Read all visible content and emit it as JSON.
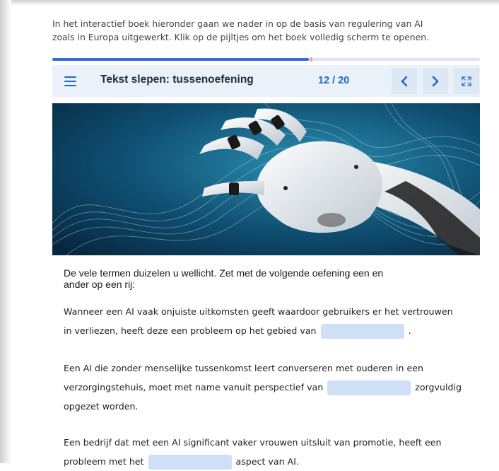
{
  "intro": {
    "line1": "In het interactief boek hieronder gaan we nader in op de basis van regulering van AI",
    "line2": "zoals in Europa uitgewerkt. Klik op de pijltjes om het boek volledig scherm te openen."
  },
  "progress": {
    "fraction": 0.6
  },
  "book": {
    "menu_icon": "hamburger-menu-icon",
    "title": "Tekst slepen: tussenoefening",
    "current_page": "12",
    "page_separator": "/",
    "total_pages": "20",
    "prev_icon": "chevron-left-icon",
    "next_icon": "chevron-right-icon",
    "fullscreen_icon": "fullscreen-icon"
  },
  "content": {
    "lead_line1": "De vele termen duizelen u wellicht. Zet met de volgende oefening een en",
    "lead_line2": "ander op een rij:",
    "q1": {
      "line1": "Wanneer een AI vaak onjuiste uitkomsten geeft waardoor gebruikers er het vertrouwen",
      "line2_before": "in verliezen, heeft deze een probleem op het gebied van",
      "line2_after": "."
    },
    "q2": {
      "line1": "Een AI die zonder menselijke tussenkomst leert converseren met ouderen in een",
      "line2_before": "verzorgingstehuis, moet met name vanuit perspectief van",
      "line2_after": "zorgvuldig",
      "line3": "opgezet worden."
    },
    "q3": {
      "line1": "Een bedrijf dat met een AI significant vaker vrouwen uitsluit van promotie, heeft een",
      "line2_before": "probleem met het",
      "line2_after": "aspect van AI."
    }
  },
  "colors": {
    "accent": "#1f67c8",
    "bar_bg": "#ebf1f8",
    "blank": "#cfe0f6"
  }
}
